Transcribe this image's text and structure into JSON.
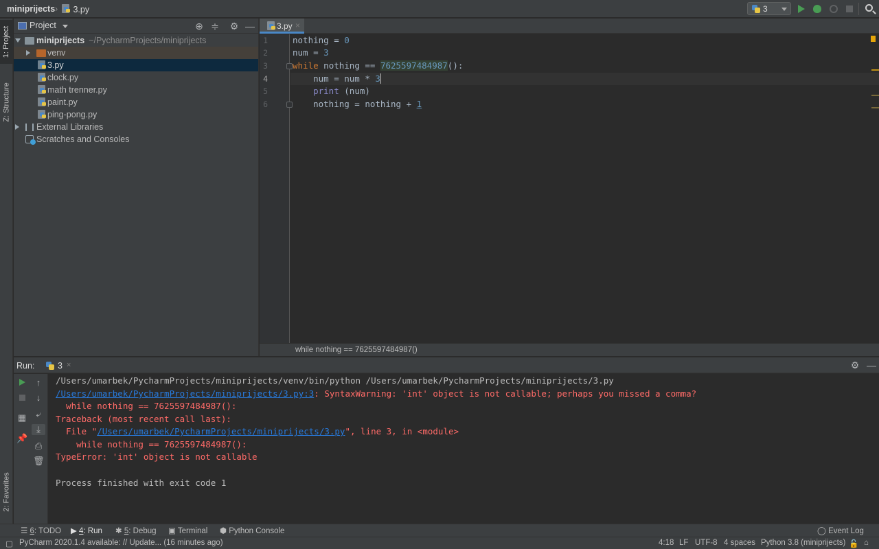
{
  "navbar": {
    "project_crumb": "miniprijects",
    "file_crumb": "3.py",
    "run_config": "3",
    "icons": [
      "python-icon",
      "run-icon",
      "debug-icon",
      "coverage-icon",
      "stop-icon",
      "search-icon"
    ]
  },
  "left_stripe": {
    "project_tab": "1: Project",
    "structure_tab": "Z: Structure",
    "favorites_tab": "2: Favorites"
  },
  "project_panel": {
    "title": "Project",
    "root": {
      "name": "miniprijects",
      "path": "~/PycharmProjects/miniprijects"
    },
    "items": [
      {
        "name": "venv",
        "type": "folder"
      },
      {
        "name": "3.py",
        "type": "file",
        "selected": true
      },
      {
        "name": "clock.py",
        "type": "file"
      },
      {
        "name": "math trenner.py",
        "type": "file"
      },
      {
        "name": "paint.py",
        "type": "file"
      },
      {
        "name": "ping-pong.py",
        "type": "file"
      }
    ],
    "external_libraries": "External Libraries",
    "scratches": "Scratches and Consoles"
  },
  "editor": {
    "tab_label": "3.py",
    "line_numbers": [
      "1",
      "2",
      "3",
      "4",
      "5",
      "6"
    ],
    "current_line": 4,
    "code": [
      "nothing = 0",
      "num = 3",
      "while nothing == 7625597484987():",
      "    num = num * 3",
      "    print (num)",
      "    nothing = nothing + 1"
    ],
    "breadcrumb": "while nothing == 7625597484987()"
  },
  "run_panel": {
    "label": "Run:",
    "tab": "3",
    "console": {
      "command": "/Users/umarbek/PycharmProjects/miniprijects/venv/bin/python /Users/umarbek/PycharmProjects/miniprijects/3.py",
      "warning_link": "/Users/umarbek/PycharmProjects/miniprijects/3.py:3",
      "warning_text": ": SyntaxWarning: 'int' object is not callable; perhaps you missed a comma?",
      "warning_code": "  while nothing == 7625597484987():",
      "traceback": "Traceback (most recent call last):",
      "file_prefix": "  File \"",
      "file_link": "/Users/umarbek/PycharmProjects/miniprijects/3.py",
      "file_suffix": "\", line 3, in <module>",
      "traceback_code": "    while nothing == 7625597484987():",
      "error": "TypeError: 'int' object is not callable",
      "exit": "Process finished with exit code 1"
    }
  },
  "bottom_tools": {
    "todo_num": "6",
    "todo": ": TODO",
    "run_num": "4",
    "run": ": Run",
    "debug_num": "5",
    "debug": ": Debug",
    "terminal": "Terminal",
    "python_console": "Python Console",
    "event_log": "Event Log"
  },
  "status_bar": {
    "message": "PyCharm 2020.1.4 available: // Update... (16 minutes ago)",
    "position": "4:18",
    "line_sep": "LF",
    "encoding": "UTF-8",
    "indent": "4 spaces",
    "interpreter": "Python 3.8 (miniprijects)"
  }
}
